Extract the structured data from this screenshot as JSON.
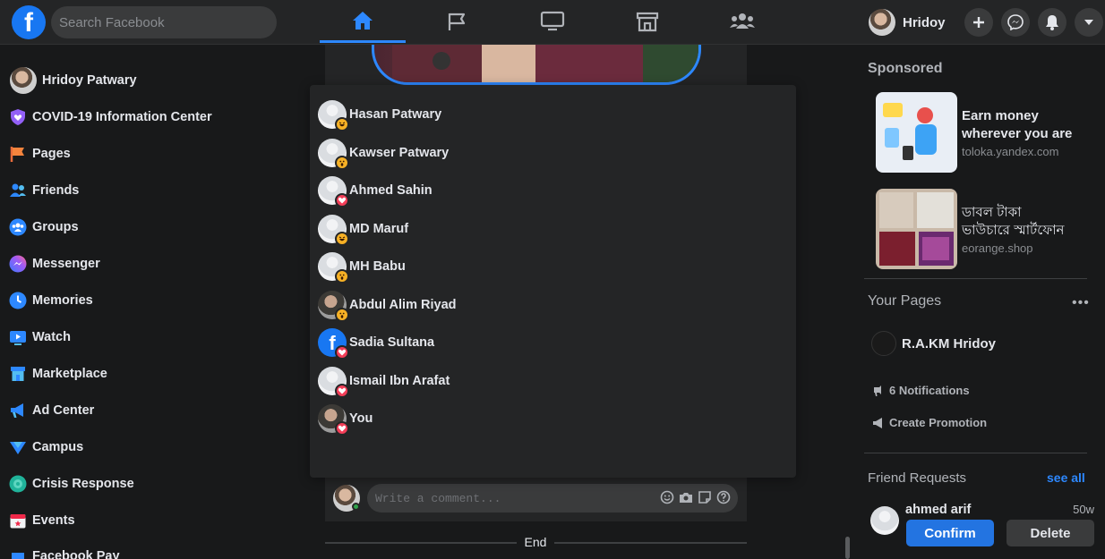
{
  "colors": {
    "accent": "#2d88ff",
    "brand": "#1877f2",
    "love": "#f33e58",
    "haha": "#f7b125",
    "confirm": "#2374e1"
  },
  "header": {
    "logo_letter": "f",
    "search_placeholder": "Search Facebook",
    "tabs": [
      {
        "icon": "home-icon",
        "active": true
      },
      {
        "icon": "flag-icon",
        "active": false
      },
      {
        "icon": "watch-icon",
        "active": false
      },
      {
        "icon": "marketplace-icon",
        "active": false
      },
      {
        "icon": "groups-icon",
        "active": false
      }
    ],
    "profile_name": "Hridoy",
    "actions": [
      "plus-icon",
      "messenger-icon",
      "bell-icon",
      "caret-down-icon"
    ]
  },
  "sidebar": {
    "items": [
      {
        "label": "Hridoy Patwary",
        "icon": "profile-avatar"
      },
      {
        "label": "COVID-19 Information Center",
        "icon": "shield-heart-icon"
      },
      {
        "label": "Pages",
        "icon": "flag-icon"
      },
      {
        "label": "Friends",
        "icon": "friends-icon"
      },
      {
        "label": "Groups",
        "icon": "groups-icon"
      },
      {
        "label": "Messenger",
        "icon": "messenger-icon"
      },
      {
        "label": "Memories",
        "icon": "clock-icon"
      },
      {
        "label": "Watch",
        "icon": "watch-icon"
      },
      {
        "label": "Marketplace",
        "icon": "marketplace-icon"
      },
      {
        "label": "Ad Center",
        "icon": "megaphone-icon"
      },
      {
        "label": "Campus",
        "icon": "campus-icon"
      },
      {
        "label": "Crisis Response",
        "icon": "crisis-icon"
      },
      {
        "label": "Events",
        "icon": "calendar-icon"
      },
      {
        "label": "Facebook Pay",
        "icon": "pay-icon"
      }
    ]
  },
  "reactions": {
    "people": [
      {
        "name": "Hasan Patwary",
        "reaction": "haha",
        "avatar": "default"
      },
      {
        "name": "Kawser Patwary",
        "reaction": "wow",
        "avatar": "default"
      },
      {
        "name": "Ahmed Sahin",
        "reaction": "love",
        "avatar": "default"
      },
      {
        "name": "MD Maruf",
        "reaction": "haha",
        "avatar": "default"
      },
      {
        "name": "MH Babu",
        "reaction": "wow",
        "avatar": "default"
      },
      {
        "name": "Abdul Alim Riyad",
        "reaction": "wow",
        "avatar": "photo"
      },
      {
        "name": "Sadia Sultana",
        "reaction": "love",
        "avatar": "fbpage"
      },
      {
        "name": "Ismail Ibn Arafat",
        "reaction": "love",
        "avatar": "default"
      },
      {
        "name": "You",
        "reaction": "love",
        "avatar": "photo"
      }
    ]
  },
  "feed": {
    "comment_placeholder": "Write a comment...",
    "end_label": "End"
  },
  "right": {
    "sponsored_heading": "Sponsored",
    "ads": [
      {
        "title_line1": "Earn money",
        "title_line2": "wherever you are",
        "domain": "toloka.yandex.com"
      },
      {
        "title_line1": "ডাবল টাকা",
        "title_line2": "ভাউচারে স্মার্টফোন",
        "domain": "eorange.shop"
      }
    ],
    "your_pages_heading": "Your Pages",
    "page_name": "R.A.KM Hridoy",
    "page_actions": [
      "6 Notifications",
      "Create Promotion"
    ],
    "friend_requests_heading": "Friend Requests",
    "see_all": "see all",
    "request": {
      "name": "ahmed arif",
      "time": "50w",
      "confirm": "Confirm",
      "delete": "Delete"
    }
  }
}
